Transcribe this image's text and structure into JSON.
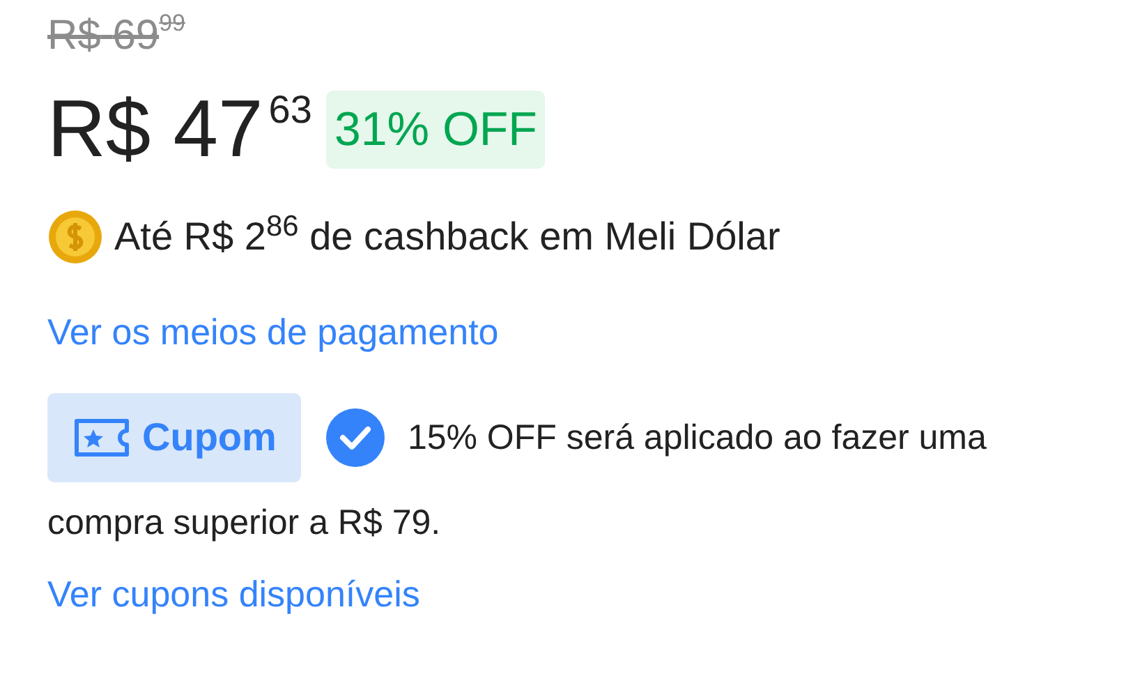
{
  "original_price": {
    "currency": "R$",
    "integer": "69",
    "cents": "99"
  },
  "price": {
    "currency": "R$",
    "integer": "47",
    "cents": "63"
  },
  "discount": "31% OFF",
  "cashback": "Até R$ 2$^{86}$ de cashback em Meli Dólar",
  "payment_link": "Ver os meios de pagamento",
  "coupon": {
    "label": "Cupom",
    "applied": true,
    "text_lines": [
      "15% OFF será aplicado ao fazer uma",
      "compra superior a R$ 79."
    ]
  },
  "coupons_link": "Ver cupons disponíveis"
}
